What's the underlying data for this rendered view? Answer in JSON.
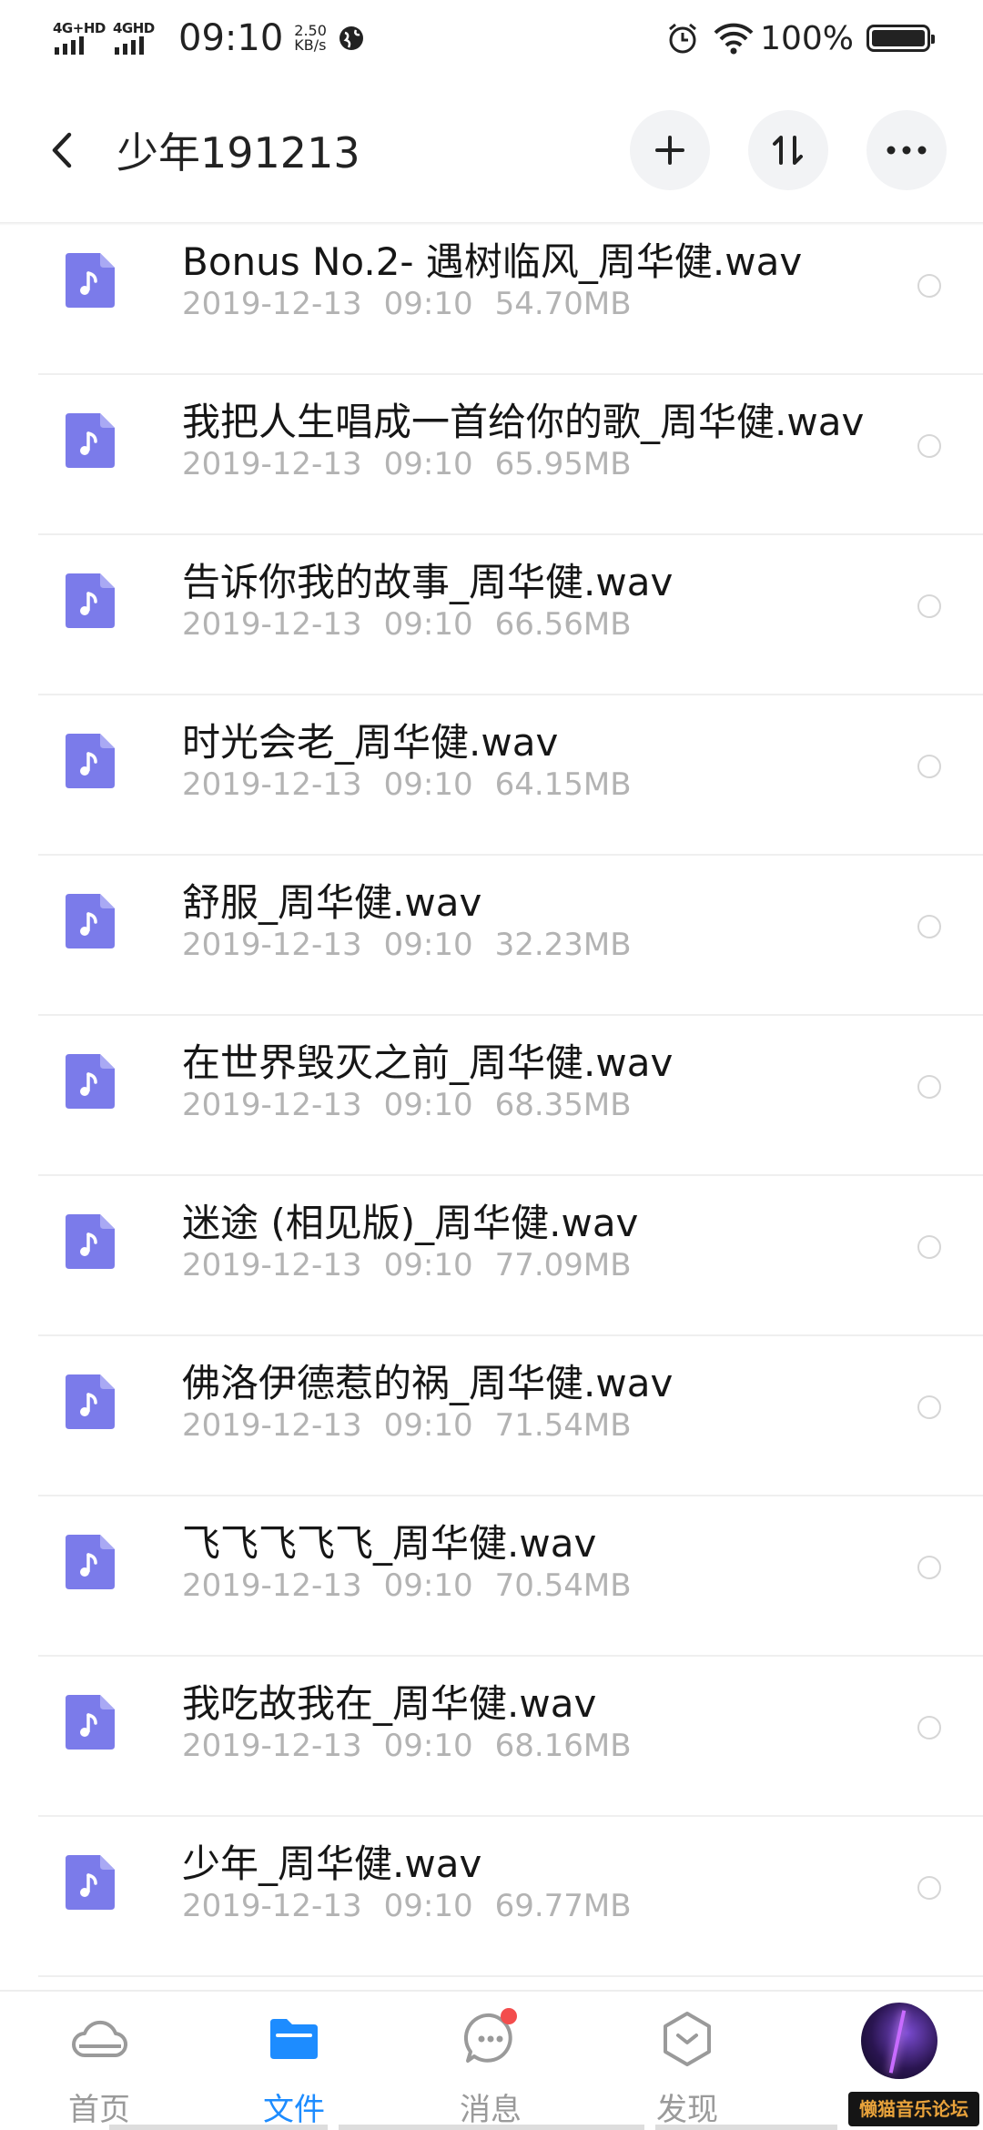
{
  "status_bar": {
    "sim1_label": "4G+HD",
    "sim2_label": "4GHD",
    "time": "09:10",
    "speed_value": "2.50",
    "speed_unit": "KB/s",
    "battery": "100%",
    "battery_level": 1.0,
    "icons": [
      "signal-icon",
      "globe-icon",
      "alarm-icon",
      "wifi-icon",
      "battery-icon"
    ]
  },
  "header": {
    "title": "少年191213",
    "icons": [
      "back-icon",
      "plus-icon",
      "sort-icon",
      "more-icon"
    ]
  },
  "files": [
    {
      "name": "Bonus No.2- 遇树临风_周华健.wav",
      "date": "2019-12-13",
      "time": "09:10",
      "size": "54.70MB"
    },
    {
      "name": "我把人生唱成一首给你的歌_周华健.wav",
      "date": "2019-12-13",
      "time": "09:10",
      "size": "65.95MB"
    },
    {
      "name": "告诉你我的故事_周华健.wav",
      "date": "2019-12-13",
      "time": "09:10",
      "size": "66.56MB"
    },
    {
      "name": "时光会老_周华健.wav",
      "date": "2019-12-13",
      "time": "09:10",
      "size": "64.15MB"
    },
    {
      "name": "舒服_周华健.wav",
      "date": "2019-12-13",
      "time": "09:10",
      "size": "32.23MB"
    },
    {
      "name": "在世界毁灭之前_周华健.wav",
      "date": "2019-12-13",
      "time": "09:10",
      "size": "68.35MB"
    },
    {
      "name": "迷途 (相见版)_周华健.wav",
      "date": "2019-12-13",
      "time": "09:10",
      "size": "77.09MB"
    },
    {
      "name": "佛洛伊德惹的祸_周华健.wav",
      "date": "2019-12-13",
      "time": "09:10",
      "size": "71.54MB"
    },
    {
      "name": "飞飞飞飞飞_周华健.wav",
      "date": "2019-12-13",
      "time": "09:10",
      "size": "70.54MB"
    },
    {
      "name": "我吃故我在_周华健.wav",
      "date": "2019-12-13",
      "time": "09:10",
      "size": "68.16MB"
    },
    {
      "name": "少年_周华健.wav",
      "date": "2019-12-13",
      "time": "09:10",
      "size": "69.77MB"
    }
  ],
  "file_icon": "music-file-icon",
  "nav": [
    {
      "label": "首页",
      "icon": "cloud-icon",
      "active": false
    },
    {
      "label": "文件",
      "icon": "folder-icon",
      "active": true
    },
    {
      "label": "消息",
      "icon": "message-icon",
      "active": false,
      "badge": true
    },
    {
      "label": "发现",
      "icon": "discover-icon",
      "active": false
    }
  ],
  "watermark": "懒猫音乐论坛",
  "colors": {
    "accent": "#1d8cff",
    "file_icon": "#7b7bea",
    "muted_text": "#b3b3b3",
    "badge": "#f34d4d"
  }
}
